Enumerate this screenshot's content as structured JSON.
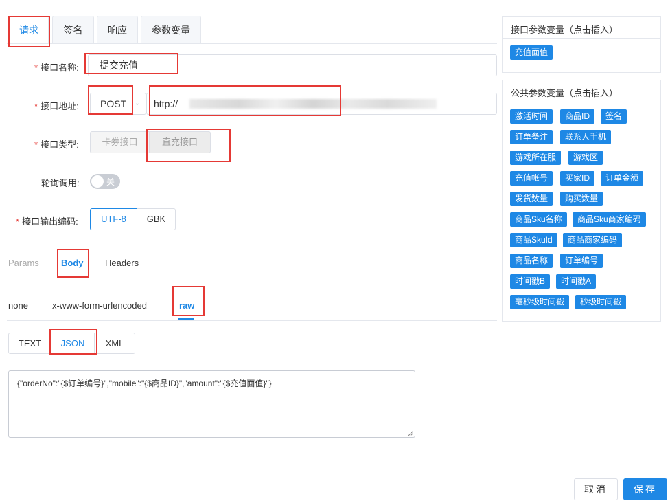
{
  "tabs": [
    "请求",
    "签名",
    "响应",
    "参数变量"
  ],
  "form": {
    "name_label": "接口名称:",
    "name_value": "提交充值",
    "url_label": "接口地址:",
    "method": "POST",
    "url_value": "http://",
    "type_label": "接口类型:",
    "type_options": [
      "卡券接口",
      "直充接口"
    ],
    "polling_label": "轮询调用:",
    "polling_state": "关",
    "encoding_label": "接口输出编码:",
    "encoding_options": [
      "UTF-8",
      "GBK"
    ]
  },
  "request_tabs": [
    "Params",
    "Body",
    "Headers"
  ],
  "body_types": [
    "none",
    "x-www-form-urlencoded",
    "raw"
  ],
  "raw_formats": [
    "TEXT",
    "JSON",
    "XML"
  ],
  "body_content": "{\"orderNo\":\"{$订单编号}\",\"mobile\":\"{$商品ID}\",\"amount\":\"{$充值面值}\"}",
  "interface_vars": {
    "title": "接口参数变量（点击插入）",
    "items": [
      "充值面值"
    ]
  },
  "public_vars": {
    "title": "公共参数变量（点击插入）",
    "items": [
      "激活时间",
      "商品ID",
      "签名",
      "订单备注",
      "联系人手机",
      "游戏所在服",
      "游戏区",
      "充值帐号",
      "买家ID",
      "订单金额",
      "发货数量",
      "购买数量",
      "商品Sku名称",
      "商品Sku商家编码",
      "商品SkuId",
      "商品商家编码",
      "商品名称",
      "订单编号",
      "时间戳B",
      "时间戳A",
      "毫秒级时间戳",
      "秒级时间戳"
    ]
  },
  "footer": {
    "cancel": "取消",
    "save": "保存"
  },
  "colors": {
    "accent": "#1e88e5",
    "highlight": "#e53935"
  }
}
